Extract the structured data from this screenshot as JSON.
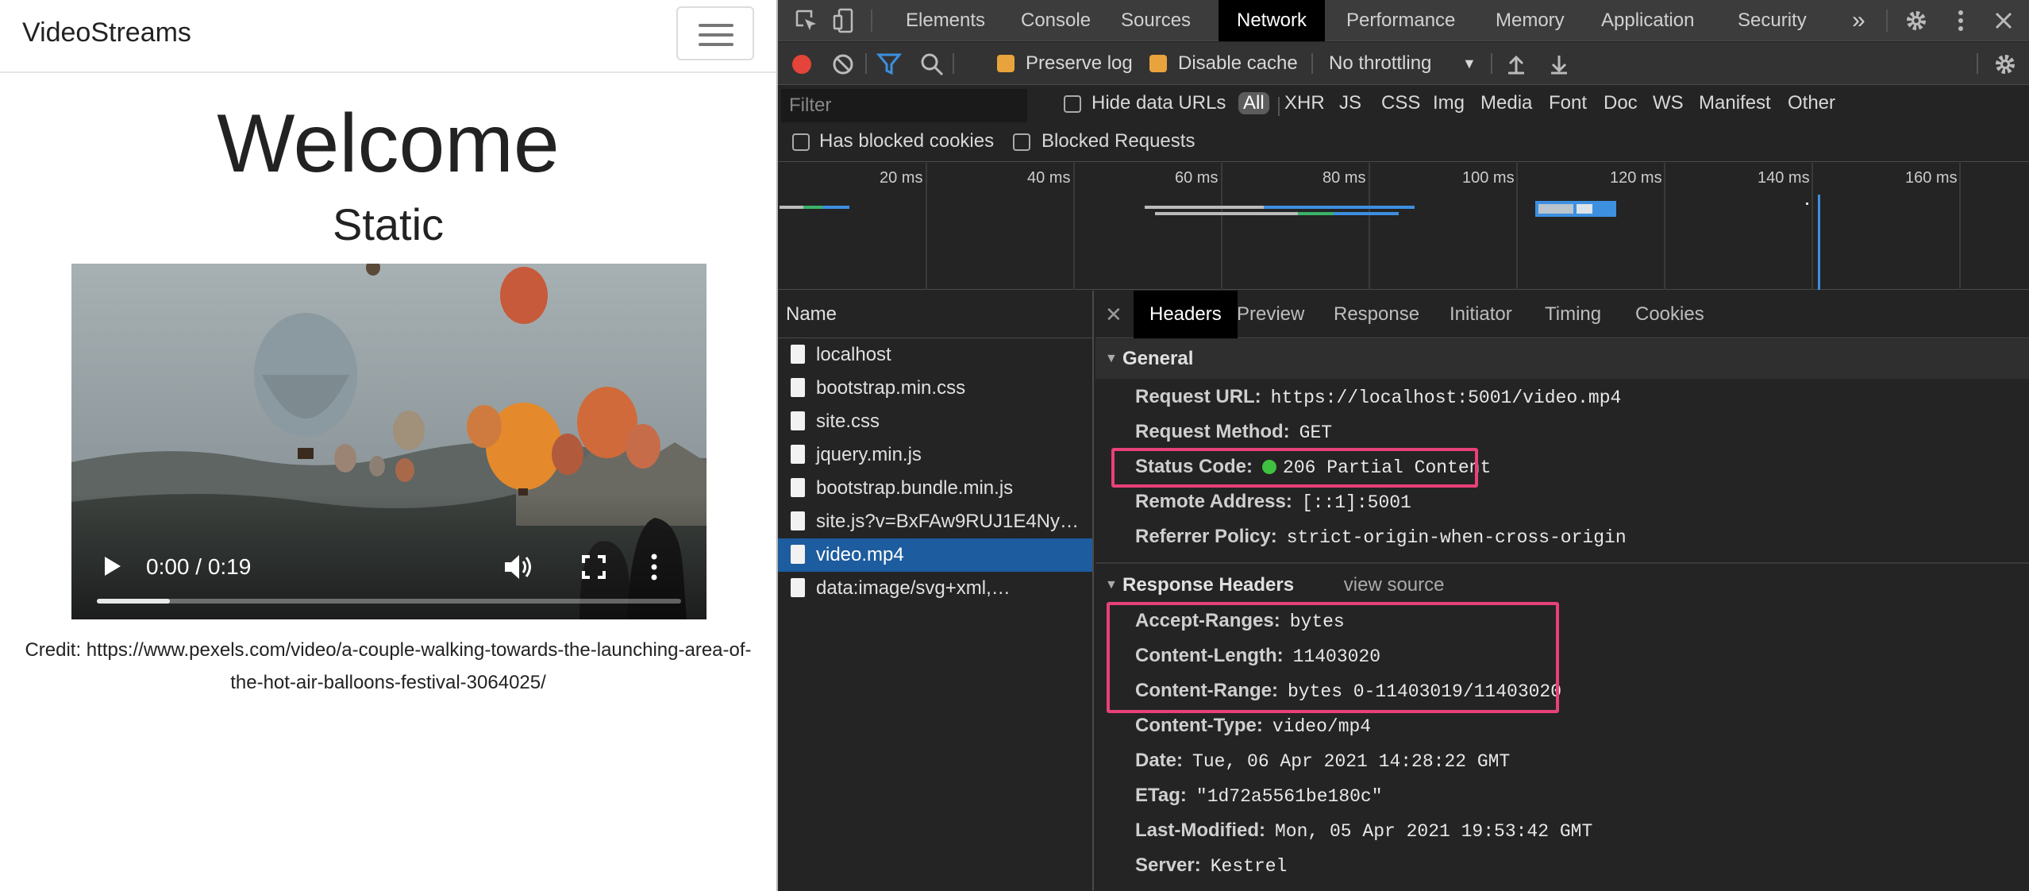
{
  "page": {
    "brand": "VideoStreams",
    "heading": "Welcome",
    "subheading": "Static",
    "video": {
      "time": "0:00 / 0:19",
      "buffered_fraction": 0.125
    },
    "credit": "Credit: https://www.pexels.com/video/a-couple-walking-towards-the-launching-area-of-the-hot-air-balloons-festival-3064025/"
  },
  "devtools": {
    "tabs": [
      "Elements",
      "Console",
      "Sources",
      "Network",
      "Performance",
      "Memory",
      "Application",
      "Security"
    ],
    "active_tab": "Network",
    "toolbar": {
      "preserve_log": "Preserve log",
      "disable_cache": "Disable cache",
      "throttling": "No throttling"
    },
    "filter": {
      "placeholder": "Filter",
      "hide_data_urls": "Hide data URLs",
      "types": [
        "All",
        "XHR",
        "JS",
        "CSS",
        "Img",
        "Media",
        "Font",
        "Doc",
        "WS",
        "Manifest",
        "Other"
      ],
      "has_blocked_cookies": "Has blocked cookies",
      "blocked_requests": "Blocked Requests"
    },
    "overview_ticks": [
      "20 ms",
      "40 ms",
      "60 ms",
      "80 ms",
      "100 ms",
      "120 ms",
      "140 ms",
      "160 ms"
    ],
    "name_header": "Name",
    "requests": [
      "localhost",
      "bootstrap.min.css",
      "site.css",
      "jquery.min.js",
      "bootstrap.bundle.min.js",
      "site.js?v=BxFAw9RUJ1E4Ny…",
      "video.mp4",
      "data:image/svg+xml,…"
    ],
    "selected_request": "video.mp4",
    "detail_tabs": [
      "Headers",
      "Preview",
      "Response",
      "Initiator",
      "Timing",
      "Cookies"
    ],
    "general": {
      "title": "General",
      "request_url_k": "Request URL:",
      "request_url_v": "https://localhost:5001/video.mp4",
      "method_k": "Request Method:",
      "method_v": "GET",
      "status_k": "Status Code:",
      "status_v": "206 Partial Content",
      "remote_k": "Remote Address:",
      "remote_v": "[::1]:5001",
      "referrer_k": "Referrer Policy:",
      "referrer_v": "strict-origin-when-cross-origin"
    },
    "response_headers": {
      "title": "Response Headers",
      "view_source": "view source",
      "accept_ranges_k": "Accept-Ranges:",
      "accept_ranges_v": "bytes",
      "content_length_k": "Content-Length:",
      "content_length_v": "11403020",
      "content_range_k": "Content-Range:",
      "content_range_v": "bytes 0-11403019/11403020",
      "content_type_k": "Content-Type:",
      "content_type_v": "video/mp4",
      "date_k": "Date:",
      "date_v": "Tue, 06 Apr 2021 14:28:22 GMT",
      "etag_k": "ETag:",
      "etag_v": "\"1d72a5561be180c\"",
      "last_modified_k": "Last-Modified:",
      "last_modified_v": "Mon, 05 Apr 2021 19:53:42 GMT",
      "server_k": "Server:",
      "server_v": "Kestrel"
    },
    "colors": {
      "highlight": "#e8407a",
      "selected_row": "#1d5c9e",
      "status_ok": "#3fc23f",
      "checkbox_on": "#e8a33d"
    }
  }
}
